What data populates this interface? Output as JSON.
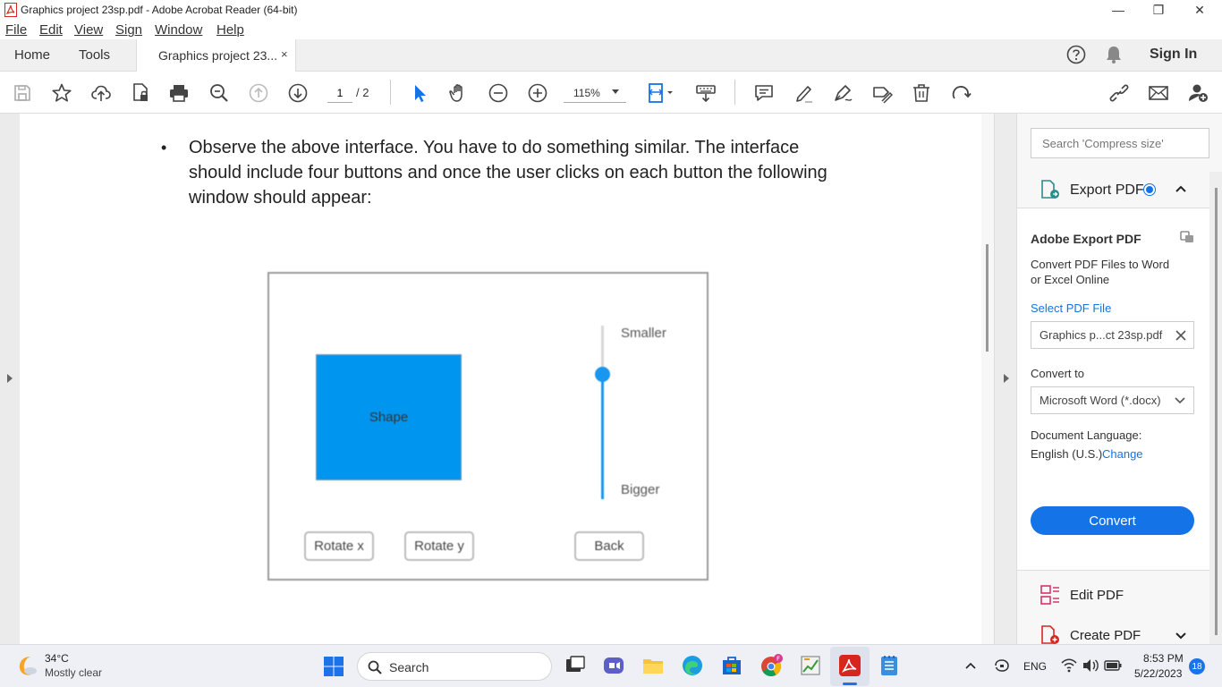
{
  "window": {
    "title": "Graphics project 23sp.pdf - Adobe Acrobat Reader (64-bit)",
    "minimize": "—",
    "maximize": "❐",
    "close": "✕"
  },
  "menu": [
    "File",
    "Edit",
    "View",
    "Sign",
    "Window",
    "Help"
  ],
  "tabs": {
    "home": "Home",
    "tools": "Tools",
    "document": "Graphics project 23...",
    "close": "×",
    "sign_in": "Sign In"
  },
  "toolbar": {
    "page_current": "1",
    "page_total": "/ 2",
    "zoom": "115%"
  },
  "document": {
    "bullet": "•",
    "text": "Observe the above interface. You have to do something similar. The interface should include four buttons and once the user clicks on each button the following window should appear:",
    "figure": {
      "shape_label": "Shape",
      "slider_top_label": "Smaller",
      "slider_bottom_label": "Bigger",
      "slider_value_fraction": 0.72,
      "buttons": [
        "Rotate x",
        "Rotate y",
        "Back"
      ]
    }
  },
  "right_panel": {
    "search_placeholder": "Search 'Compress size'",
    "export_title": "Export PDF",
    "section_title": "Adobe Export PDF",
    "description": "Convert PDF Files to Word or Excel Online",
    "select_file_link": "Select PDF File",
    "selected_file": "Graphics p...ct 23sp.pdf",
    "convert_to_label": "Convert to",
    "convert_to_value": "Microsoft Word (*.docx)",
    "doc_lang_label": "Document Language:",
    "doc_lang_value": "English (U.S.)",
    "change_link": "Change",
    "convert_button": "Convert",
    "edit_pdf": "Edit PDF",
    "create_pdf": "Create PDF"
  },
  "taskbar": {
    "weather_temp": "34°C",
    "weather_desc": "Mostly clear",
    "search_label": "Search",
    "language": "ENG",
    "time": "8:53 PM",
    "date": "5/22/2023",
    "notification_count": "18"
  },
  "colors": {
    "accent_blue": "#1473e6",
    "shape_fill": "#0096f0",
    "acrobat_red": "#d7261e"
  }
}
